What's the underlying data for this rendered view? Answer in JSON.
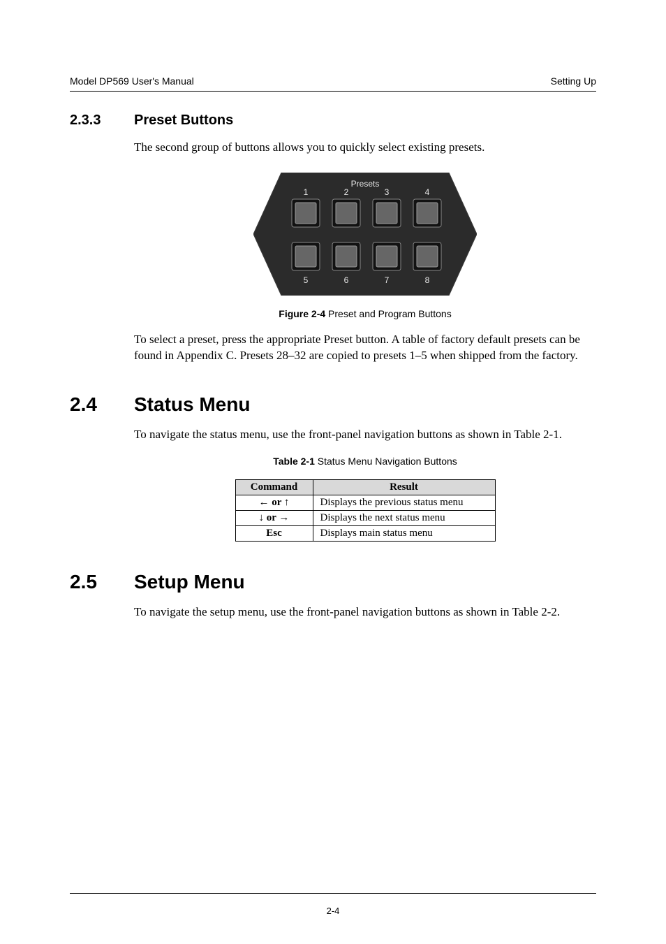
{
  "header": {
    "left": "Model DP569 User's Manual",
    "right": "Setting Up"
  },
  "sec233": {
    "num": "2.3.3",
    "title": "Preset Buttons",
    "intro": "The second group of buttons allows you to quickly select existing presets.",
    "figure_caption_bold": "Figure 2-4",
    "figure_caption_rest": " Preset and Program Buttons",
    "after_fig": "To select a preset, press the appropriate Preset button. A table of factory default presets can be found in Appendix C. Presets 28–32 are copied to presets 1–5 when shipped from the factory.",
    "panel": {
      "label_top": "Presets",
      "nums_top": [
        "1",
        "2",
        "3",
        "4"
      ],
      "nums_bottom": [
        "5",
        "6",
        "7",
        "8"
      ]
    }
  },
  "sec24": {
    "num": "2.4",
    "title": "Status Menu",
    "intro": "To navigate the status menu, use the front-panel navigation buttons as shown in Table 2-1.",
    "table_caption_bold": "Table 2-1",
    "table_caption_rest": " Status Menu Navigation Buttons",
    "table": {
      "headers": [
        "Command",
        "Result"
      ],
      "rows": [
        {
          "cmd": "← or ↑",
          "res": "Displays the previous status menu"
        },
        {
          "cmd": "↓ or →",
          "res": "Displays the next status menu"
        },
        {
          "cmd": "Esc",
          "res": "Displays main status menu"
        }
      ]
    }
  },
  "sec25": {
    "num": "2.5",
    "title": "Setup Menu",
    "intro": "To navigate the setup menu, use the front-panel navigation buttons as shown in Table 2-2."
  },
  "footer": {
    "page": "2-4"
  },
  "chart_data": {
    "type": "table",
    "title": "Table 2-1 Status Menu Navigation Buttons",
    "columns": [
      "Command",
      "Result"
    ],
    "rows": [
      [
        "← or ↑",
        "Displays the previous status menu"
      ],
      [
        "↓ or →",
        "Displays the next status menu"
      ],
      [
        "Esc",
        "Displays main status menu"
      ]
    ]
  }
}
